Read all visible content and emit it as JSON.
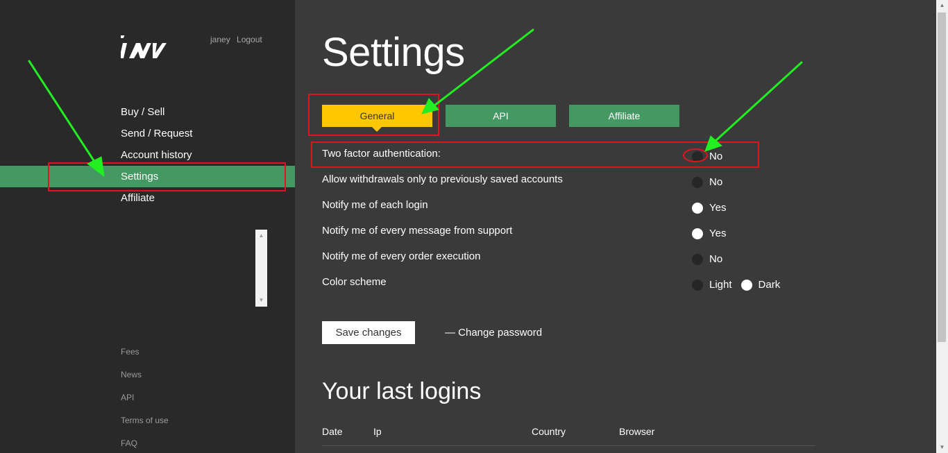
{
  "header": {
    "logo_icon": "iw-logo-icon",
    "username": "janey",
    "logout_label": "Logout"
  },
  "sidebar": {
    "items": [
      {
        "label": "Buy / Sell"
      },
      {
        "label": "Send / Request"
      },
      {
        "label": "Account history"
      },
      {
        "label": "Settings",
        "active": true
      },
      {
        "label": "Affiliate"
      }
    ],
    "footer": [
      "Fees",
      "News",
      "API",
      "Terms of use",
      "FAQ"
    ]
  },
  "main": {
    "title": "Settings",
    "tabs": [
      {
        "label": "General",
        "active": true
      },
      {
        "label": "API"
      },
      {
        "label": "Affiliate"
      }
    ],
    "settings": [
      {
        "label": "Two factor authentication:",
        "options": [
          {
            "label": "No",
            "checked": false
          }
        ]
      },
      {
        "label": "Allow withdrawals only to previously saved accounts",
        "options": [
          {
            "label": "No",
            "checked": false
          }
        ]
      },
      {
        "label": "Notify me of each login",
        "options": [
          {
            "label": "Yes",
            "checked": true
          }
        ]
      },
      {
        "label": "Notify me of every message from support",
        "options": [
          {
            "label": "Yes",
            "checked": true
          }
        ]
      },
      {
        "label": "Notify me of every order execution",
        "options": [
          {
            "label": "No",
            "checked": false
          }
        ]
      },
      {
        "label": "Color scheme",
        "options": [
          {
            "label": "Light",
            "checked": false
          },
          {
            "label": "Dark",
            "checked": true
          }
        ]
      }
    ],
    "save_label": "Save changes",
    "change_password_label": "— Change password",
    "logins": {
      "title": "Your last logins",
      "columns": [
        "Date",
        "Ip",
        "Country",
        "Browser"
      ]
    }
  },
  "colors": {
    "sidebar_bg": "#292929",
    "main_bg": "#3a3a3a",
    "accent_green": "#449962",
    "accent_yellow": "#ffc700",
    "annotation_red": "#e0141e",
    "annotation_arrow": "#22ee22"
  }
}
